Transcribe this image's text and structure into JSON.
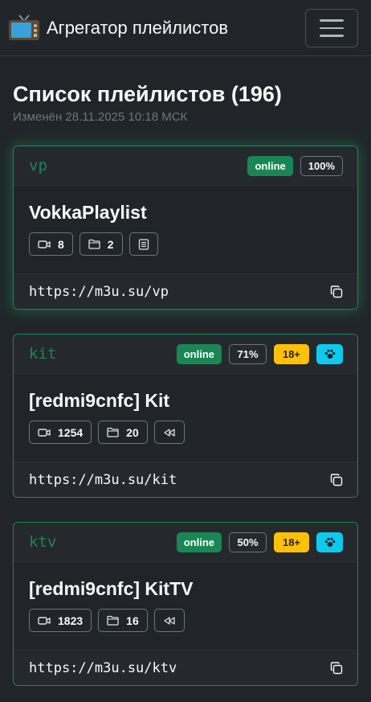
{
  "navbar": {
    "title": "Агрегатор плейлистов",
    "brand_icon": "tv-icon",
    "menu_icon": "hamburger-icon"
  },
  "page": {
    "title": "Список плейлистов (196)",
    "subtitle": "Изменён 28.11.2025 10:18 МСК"
  },
  "colors": {
    "success": "#198754",
    "warning": "#ffc107",
    "info": "#0dcaf0",
    "background": "#212529"
  },
  "playlists": [
    {
      "code": "vp",
      "status": "online",
      "percent": "100%",
      "name": "VokkaPlaylist",
      "channels": "8",
      "groups": "2",
      "url": "https://m3u.su/vp"
    },
    {
      "code": "kit",
      "status": "online",
      "percent": "71%",
      "adult": "18+",
      "name": "[redmi9cnfc] Kit",
      "channels": "1254",
      "groups": "20",
      "url": "https://m3u.su/kit"
    },
    {
      "code": "ktv",
      "status": "online",
      "percent": "50%",
      "adult": "18+",
      "name": "[redmi9cnfc] KitTV",
      "channels": "1823",
      "groups": "16",
      "url": "https://m3u.su/ktv"
    }
  ]
}
